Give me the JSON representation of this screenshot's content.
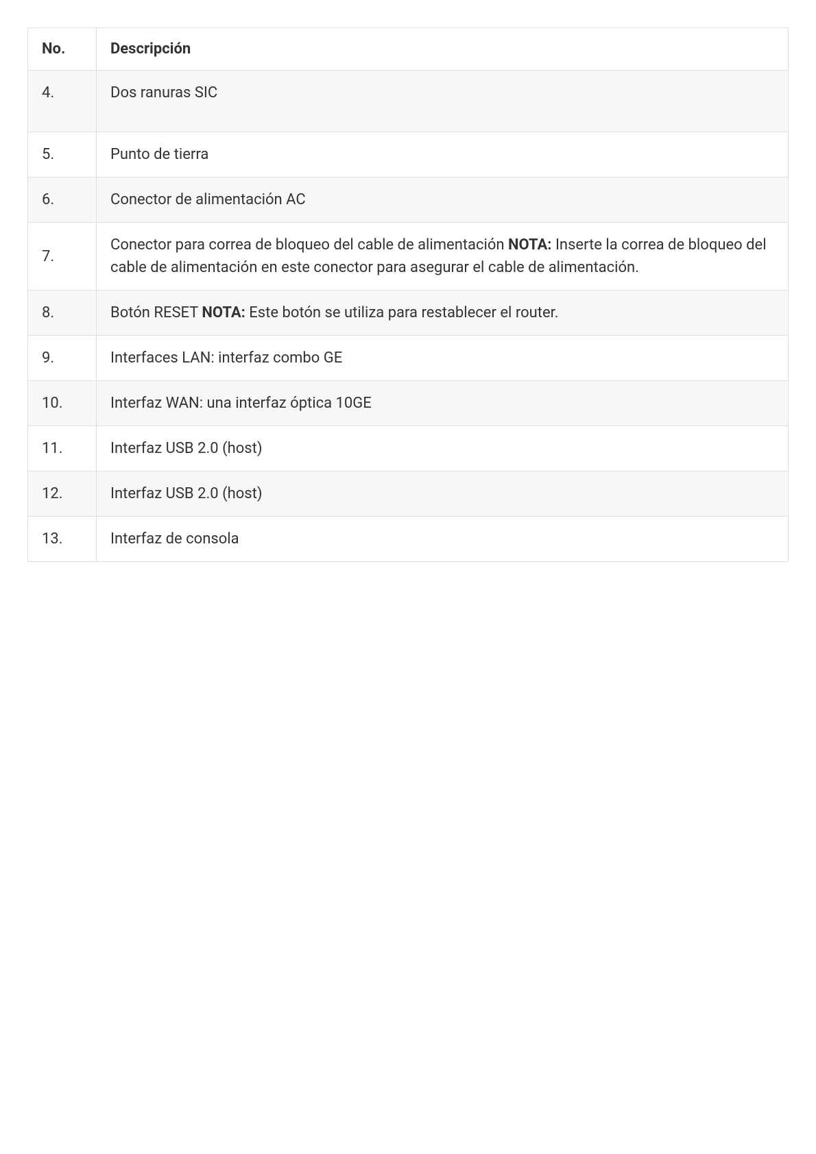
{
  "table": {
    "headers": {
      "no": "No.",
      "desc": "Descripción"
    },
    "rows": [
      {
        "no": "4.",
        "desc_parts": [
          {
            "text": "Dos ranuras SIC",
            "bold": false
          }
        ],
        "tall": true
      },
      {
        "no": "5.",
        "desc_parts": [
          {
            "text": "Punto de tierra",
            "bold": false
          }
        ]
      },
      {
        "no": "6.",
        "desc_parts": [
          {
            "text": "Conector de alimentación AC",
            "bold": false
          }
        ]
      },
      {
        "no": "7.",
        "desc_parts": [
          {
            "text": "Conector para correa de bloqueo del cable de alimentación ",
            "bold": false
          },
          {
            "text": "NOTA:",
            "bold": true
          },
          {
            "text": " Inserte la correa de bloqueo del cable de alimentación en este conector para asegurar el cable de alimentación.",
            "bold": false
          }
        ]
      },
      {
        "no": "8.",
        "desc_parts": [
          {
            "text": "Botón RESET ",
            "bold": false
          },
          {
            "text": "NOTA:",
            "bold": true
          },
          {
            "text": " Este botón se utiliza para restablecer el router.",
            "bold": false
          }
        ]
      },
      {
        "no": "9.",
        "desc_parts": [
          {
            "text": "Interfaces LAN: interfaz combo GE",
            "bold": false
          }
        ]
      },
      {
        "no": "10.",
        "desc_parts": [
          {
            "text": "Interfaz WAN: una interfaz óptica 10GE",
            "bold": false
          }
        ]
      },
      {
        "no": "11.",
        "desc_parts": [
          {
            "text": "Interfaz USB 2.0 (host)",
            "bold": false
          }
        ]
      },
      {
        "no": "12.",
        "desc_parts": [
          {
            "text": "Interfaz USB 2.0 (host)",
            "bold": false
          }
        ]
      },
      {
        "no": "13.",
        "desc_parts": [
          {
            "text": "Interfaz de consola",
            "bold": false
          }
        ]
      }
    ]
  }
}
